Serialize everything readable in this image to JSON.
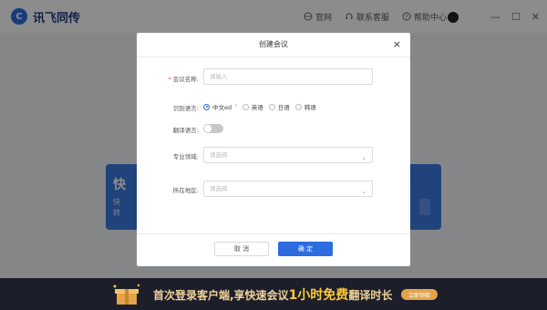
{
  "app": {
    "logo_text": "讯飞同传",
    "header_links": [
      "官网",
      "联系客服",
      "帮助中心"
    ],
    "window_controls": [
      "—",
      "☐",
      "✕"
    ]
  },
  "main_card": {
    "title": "快",
    "line1": "快",
    "line2": "转"
  },
  "dialog": {
    "title": "创建会议",
    "close": "×",
    "meeting_name_label": "会议名称:",
    "meeting_name_placeholder": "请输入",
    "language_label": "识别语言:",
    "languages": [
      {
        "label": "中文ed",
        "selected": true
      },
      {
        "label": "英语",
        "selected": false
      },
      {
        "label": "日语",
        "selected": false
      },
      {
        "label": "韩语",
        "selected": false
      }
    ],
    "help_mark": "?",
    "translate_label": "翻译语言:",
    "translate_enabled": false,
    "field_label": "专业领域:",
    "field_placeholder": "请选择",
    "region_label": "所在地区:",
    "region_placeholder": "请选择",
    "cancel_label": "取 消",
    "ok_label": "确 定"
  },
  "banner": {
    "text_before": "首次登录客户端,享快速会议",
    "highlight": "1小时免费",
    "text_after": "翻译时长",
    "button": "立即领取"
  },
  "colors": {
    "primary": "#2d6cdf",
    "banner_bg": "#1c1f2a",
    "banner_highlight": "#ffca3a"
  }
}
